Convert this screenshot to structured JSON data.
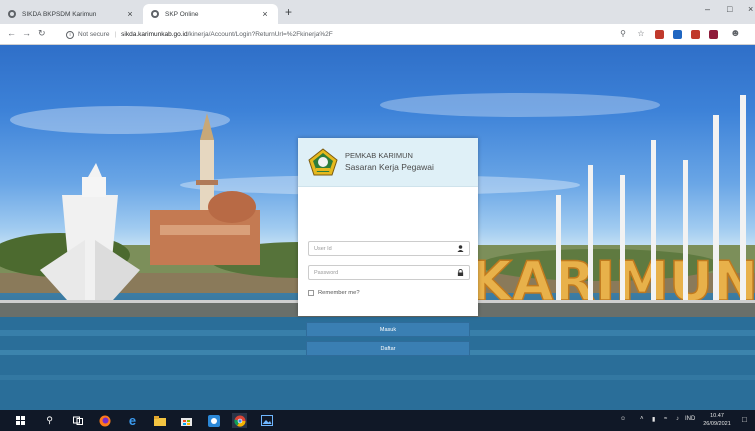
{
  "browser": {
    "tabs": [
      {
        "label": "SIKDA BKPSDM Karimun",
        "close": "×"
      },
      {
        "label": "SKP Online",
        "close": "×"
      }
    ],
    "new_tab": "+",
    "window_controls": {
      "minimize": "–",
      "maximize": "□",
      "close": "×"
    },
    "security_label": "Not secure",
    "url_host": "sikda.karimunkab.go.id",
    "url_path": "/kinerja/Account/Login?ReturnUrl=%2Fkinerja%2F",
    "nav_icons": [
      "back-arrow-icon",
      "forward-arrow-icon",
      "reload-icon"
    ],
    "toolbar_icons": [
      "zoom-icon",
      "bookmark-star-icon",
      "profile-icon"
    ],
    "extension_colors": [
      "#c0392b",
      "#1f66c1",
      "#c0392b",
      "#8e1b3a"
    ]
  },
  "login": {
    "org_name": "PEMKAB KARIMUN",
    "app_name": "Sasaran Kerja Pegawai",
    "userid_placeholder": "User Id",
    "password_placeholder": "Password",
    "remember_label": "Remember me?",
    "login_button": "Masuk",
    "register_button": "Daftar",
    "accent_color": "#3a7fb3"
  },
  "background": {
    "sign_text": "KARIMUN"
  },
  "taskbar": {
    "apps": [
      "windows-start-icon",
      "search-icon",
      "task-view-icon",
      "firefox-icon",
      "edge-icon",
      "file-explorer-icon",
      "store-icon",
      "mail-icon",
      "chrome-icon",
      "photos-icon"
    ],
    "language": "IND",
    "time": "10.47",
    "date": "26/09/2021"
  }
}
